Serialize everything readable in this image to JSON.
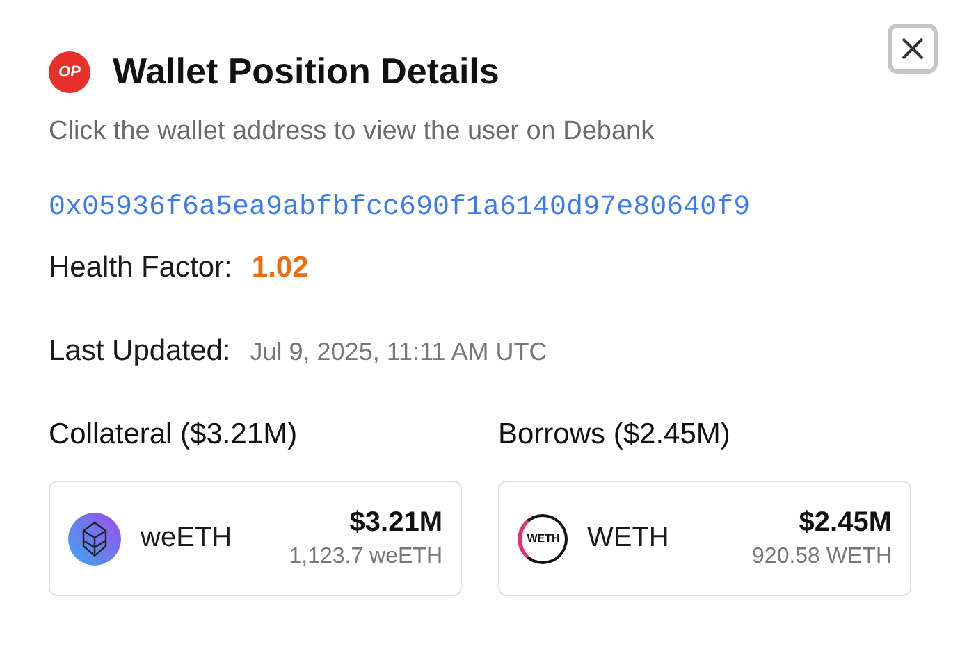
{
  "header": {
    "badge": "OP",
    "title": "Wallet Position Details"
  },
  "hint": "Click the wallet address to view the user on Debank",
  "address": "0x05936f6a5ea9abfbfcc690f1a6140d97e80640f9",
  "health": {
    "label": "Health Factor:",
    "value": "1.02"
  },
  "updated": {
    "label": "Last Updated:",
    "value": "Jul 9, 2025, 11:11 AM UTC"
  },
  "sections": [
    {
      "title": "Collateral ($3.21M)",
      "assets": [
        {
          "kind": "weeth",
          "symbol": "weETH",
          "usd": "$3.21M",
          "amount": "1,123.7 weETH"
        }
      ]
    },
    {
      "title": "Borrows ($2.45M)",
      "assets": [
        {
          "kind": "weth",
          "logo": "WETH",
          "symbol": "WETH",
          "usd": "$2.45M",
          "amount": "920.58 WETH"
        }
      ]
    }
  ]
}
